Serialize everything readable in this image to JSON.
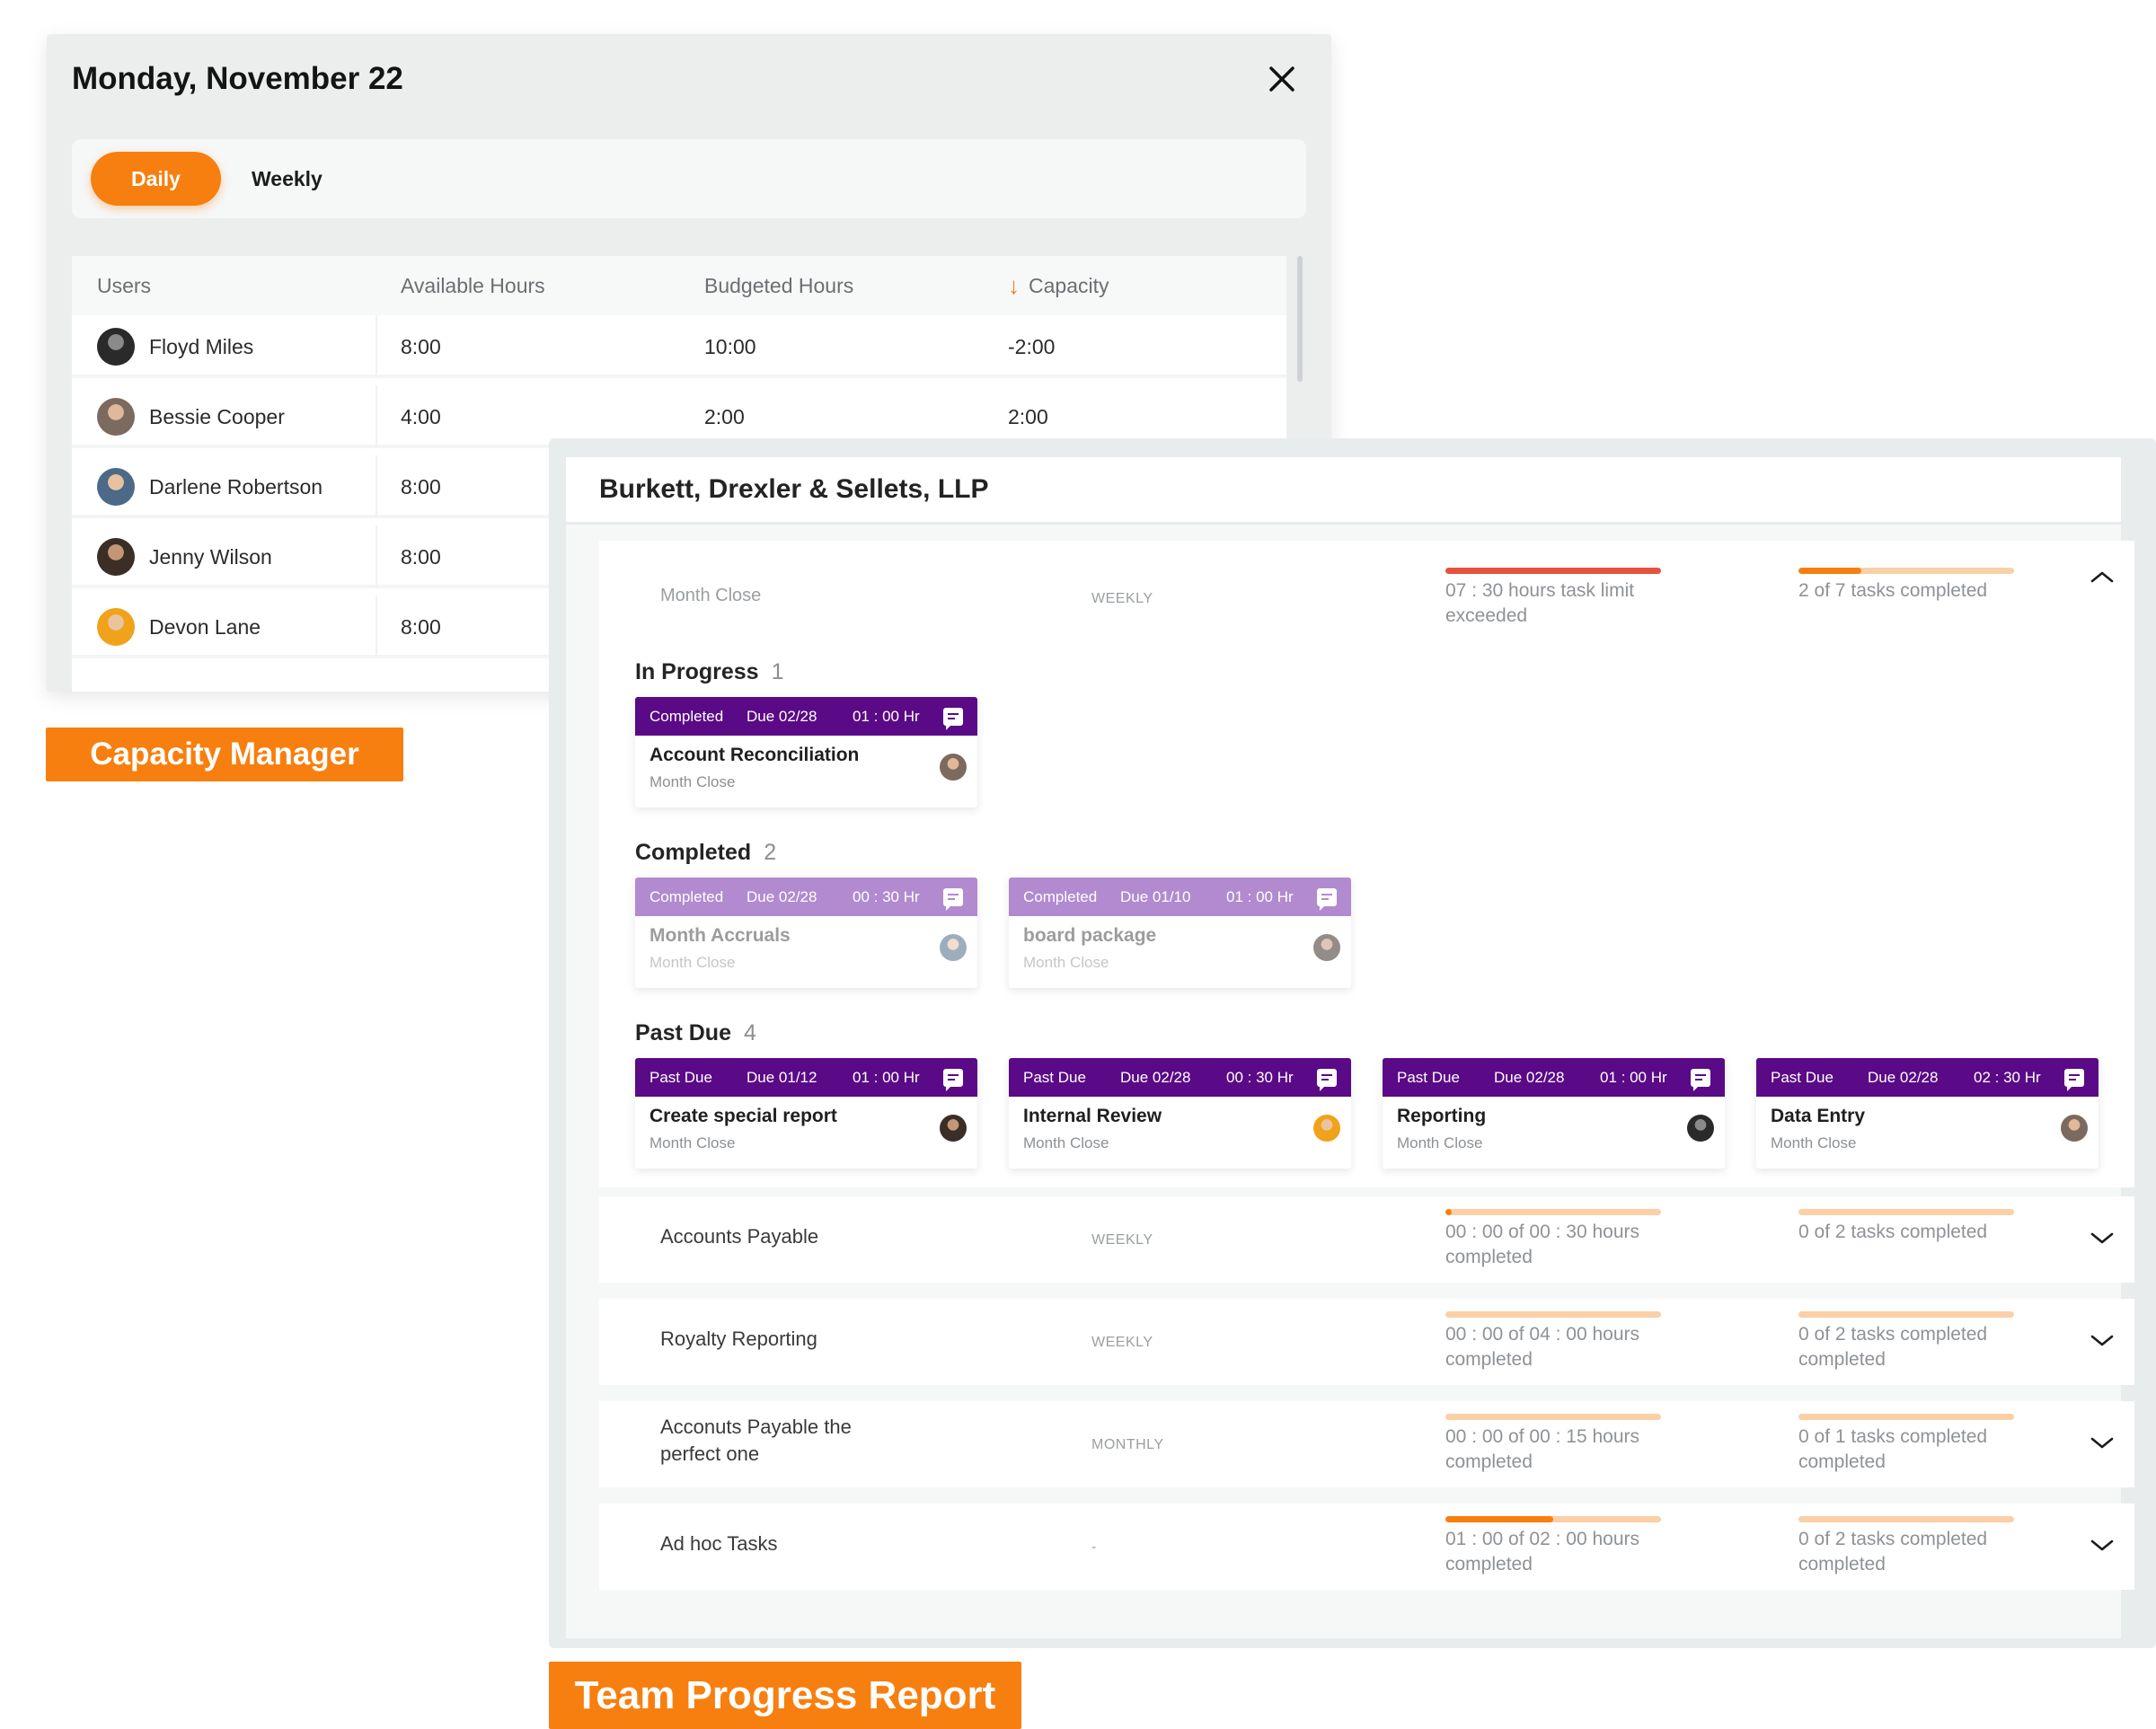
{
  "capacity": {
    "title": "Monday, November 22",
    "toggle": {
      "daily": "Daily",
      "weekly": "Weekly"
    },
    "columns": [
      "Users",
      "Available Hours",
      "Budgeted Hours",
      "Capacity"
    ],
    "rows": [
      {
        "name": "Floyd Miles",
        "available": "8:00",
        "budgeted": "10:00",
        "capacity": "-2:00"
      },
      {
        "name": "Bessie Cooper",
        "available": "4:00",
        "budgeted": "2:00",
        "capacity": "2:00"
      },
      {
        "name": "Darlene Robertson",
        "available": "8:00",
        "budgeted": "",
        "capacity": ""
      },
      {
        "name": "Jenny Wilson",
        "available": "8:00",
        "budgeted": "",
        "capacity": ""
      },
      {
        "name": "Devon Lane",
        "available": "8:00",
        "budgeted": "",
        "capacity": ""
      }
    ],
    "label": "Capacity Manager",
    "colors": {
      "accent": "#f77f0f",
      "negative": "#e5533d"
    }
  },
  "report": {
    "firm": "Burkett, Drexler & Sellets, LLP",
    "label": "Team Progress Report",
    "sections": [
      {
        "name": "Month Close",
        "frequency": "WEEKLY",
        "hours_text": "07 : 30 hours task limit exceeded",
        "hours_progress": 1.0,
        "tasks_text": "2 of 7 tasks completed",
        "tasks_progress": 0.29,
        "expanded": true
      },
      {
        "name": "Accounts Payable",
        "frequency": "WEEKLY",
        "hours_text": "00 : 00 of 00 : 30 hours completed",
        "hours_progress": 0.03,
        "tasks_text": "0 of 2 tasks completed",
        "tasks_progress": 0,
        "expanded": false
      },
      {
        "name": "Royalty Reporting",
        "frequency": "WEEKLY",
        "hours_text": "00 : 00 of 04 : 00 hours completed",
        "hours_progress": 0,
        "tasks_text": "0 of 2 tasks completed completed",
        "tasks_progress": 0,
        "expanded": false
      },
      {
        "name": "Acconuts Payable the perfect one",
        "frequency": "MONTHLY",
        "hours_text": "00 : 00 of 00 : 15 hours completed",
        "hours_progress": 0,
        "tasks_text": "0 of 1 tasks completed completed",
        "tasks_progress": 0,
        "expanded": false
      },
      {
        "name": "Ad hoc Tasks",
        "frequency": "-",
        "hours_text": "01 : 00 of 02 : 00 hours completed",
        "hours_progress": 0.5,
        "tasks_text": "0 of 2 tasks completed completed",
        "tasks_progress": 0,
        "expanded": false
      }
    ],
    "groups": [
      {
        "title": "In Progress",
        "count": "1",
        "tasks": [
          {
            "status": "Completed",
            "due": "Due 02/28",
            "hours": "01 : 00 Hr",
            "name": "Account Reconciliation",
            "sub": "Month Close",
            "faded": false
          }
        ]
      },
      {
        "title": "Completed",
        "count": "2",
        "tasks": [
          {
            "status": "Completed",
            "due": "Due 02/28",
            "hours": "00 : 30 Hr",
            "name": "Month Accruals",
            "sub": "Month Close",
            "faded": true
          },
          {
            "status": "Completed",
            "due": "Due 01/10",
            "hours": "01 : 00 Hr",
            "name": "board package",
            "sub": "Month Close",
            "faded": true
          }
        ]
      },
      {
        "title": "Past Due",
        "count": "4",
        "tasks": [
          {
            "status": "Past Due",
            "due": "Due 01/12",
            "hours": "01 : 00 Hr",
            "name": "Create special report",
            "sub": "Month Close",
            "faded": false
          },
          {
            "status": "Past Due",
            "due": "Due 02/28",
            "hours": "00 : 30 Hr",
            "name": "Internal Review",
            "sub": "Month Close",
            "faded": false
          },
          {
            "status": "Past Due",
            "due": "Due 02/28",
            "hours": "01 : 00 Hr",
            "name": "Reporting",
            "sub": "Month Close",
            "faded": false
          },
          {
            "status": "Past Due",
            "due": "Due 02/28",
            "hours": "02 : 30 Hr",
            "name": "Data Entry",
            "sub": "Month Close",
            "faded": false
          }
        ]
      }
    ],
    "colors": {
      "task_header": "#5a0a86",
      "task_header_done": "#b18ad0",
      "bar_track": "#fbd0a6",
      "bar_orange": "#f77f0f",
      "bar_red": "#e5533d"
    }
  }
}
